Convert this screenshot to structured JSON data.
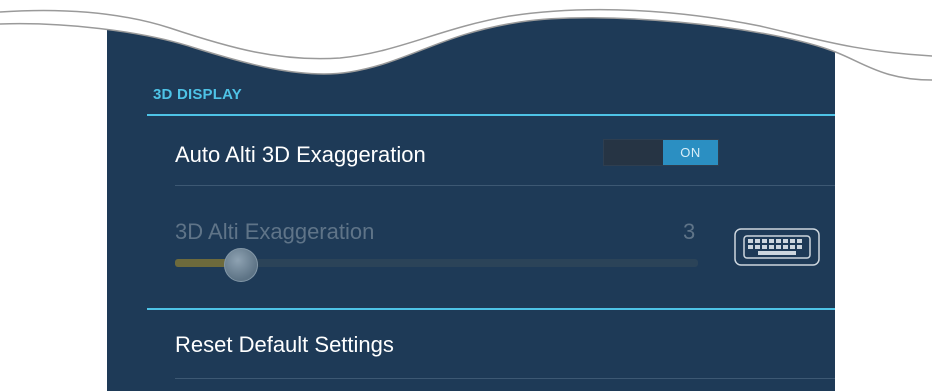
{
  "section": {
    "title": "3D DISPLAY"
  },
  "auto_exaggeration": {
    "label": "Auto Alti 3D Exaggeration",
    "toggle_state": "ON"
  },
  "exaggeration": {
    "label": "3D Alti Exaggeration",
    "value": "3",
    "slider_fraction": 0.12
  },
  "reset": {
    "label": "Reset Default Settings"
  },
  "icons": {
    "keyboard": "keyboard-icon"
  },
  "colors": {
    "panel_bg": "#1e3a57",
    "accent": "#4ec3e6",
    "toggle_on": "#2b8fc2",
    "disabled_text": "#5f7488"
  }
}
